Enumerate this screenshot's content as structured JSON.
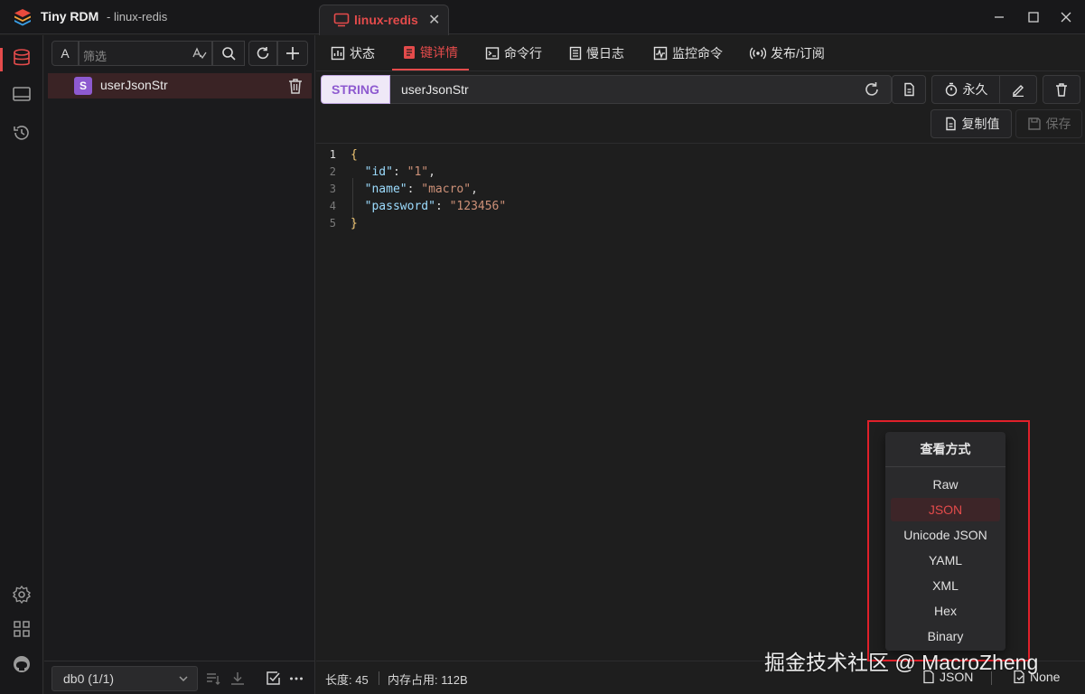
{
  "window": {
    "app_name": "Tiny RDM",
    "connection": "linux-redis",
    "tab_label": "linux-redis",
    "tab_close": "✕"
  },
  "browser": {
    "filter_type_label": "A",
    "filter_placeholder": "筛选",
    "keys": [
      {
        "type_badge": "S",
        "name": "userJsonStr"
      }
    ],
    "db_select": "db0 (1/1)"
  },
  "content_tabs": [
    {
      "label": "状态",
      "icon": "status-icon"
    },
    {
      "label": "键详情",
      "icon": "key-detail-icon"
    },
    {
      "label": "命令行",
      "icon": "terminal-icon"
    },
    {
      "label": "慢日志",
      "icon": "slow-log-icon"
    },
    {
      "label": "监控命令",
      "icon": "monitor-icon"
    },
    {
      "label": "发布/订阅",
      "icon": "pubsub-icon"
    }
  ],
  "key_detail": {
    "type": "STRING",
    "key_name": "userJsonStr",
    "ttl_label": "永久",
    "copy_value_label": "复制值",
    "save_label": "保存"
  },
  "editor": {
    "line_numbers": [
      "1",
      "2",
      "3",
      "4",
      "5"
    ],
    "open_brace": "{",
    "close_brace": "}",
    "pairs": [
      {
        "key": "\"id\"",
        "value": "\"1\"",
        "comma": ","
      },
      {
        "key": "\"name\"",
        "value": "\"macro\"",
        "comma": ","
      },
      {
        "key": "\"password\"",
        "value": "\"123456\"",
        "comma": ""
      }
    ]
  },
  "status_bar": {
    "length": "长度: 45",
    "memory": "内存占用: 112B",
    "view_format": "JSON",
    "decode": "None"
  },
  "view_menu": {
    "title": "查看方式",
    "items": [
      "Raw",
      "JSON",
      "Unicode JSON",
      "YAML",
      "XML",
      "Hex",
      "Binary"
    ],
    "selected": "JSON"
  },
  "watermark": "掘金技术社区 @ MacroZheng",
  "colors": {
    "accent": "#e44b4b",
    "string_type": "#8e5ad0",
    "highlight_box": "#e0202a"
  }
}
